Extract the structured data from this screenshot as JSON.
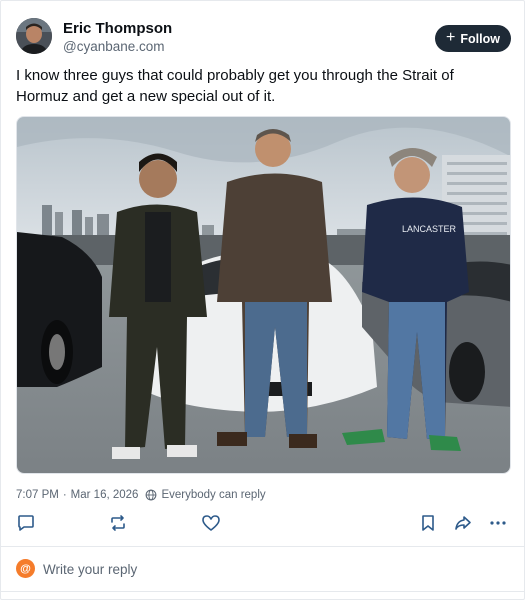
{
  "author": {
    "name": "Eric Thompson",
    "handle": "@cyanbane.com"
  },
  "follow_button": {
    "icon": "plus-icon",
    "label": "Follow"
  },
  "post": {
    "text": "I know three guys that could probably get you through the Strait of Hormuz and get a new special out of it."
  },
  "meta": {
    "time": "7:07 PM",
    "separator": "·",
    "date": "Mar 16, 2026",
    "reply_setting_icon": "globe-icon",
    "reply_setting": "Everybody can reply"
  },
  "actions": [
    {
      "name": "reply-icon"
    },
    {
      "name": "repost-icon"
    },
    {
      "name": "like-icon"
    },
    {
      "name": "bookmark-icon"
    },
    {
      "name": "share-icon"
    },
    {
      "name": "more-icon"
    }
  ],
  "reply_box": {
    "placeholder": "Write your reply"
  },
  "colors": {
    "follow_bg": "#1e2a36",
    "reply_avatar": "#f57c2b",
    "muted_text": "#5b6673"
  }
}
